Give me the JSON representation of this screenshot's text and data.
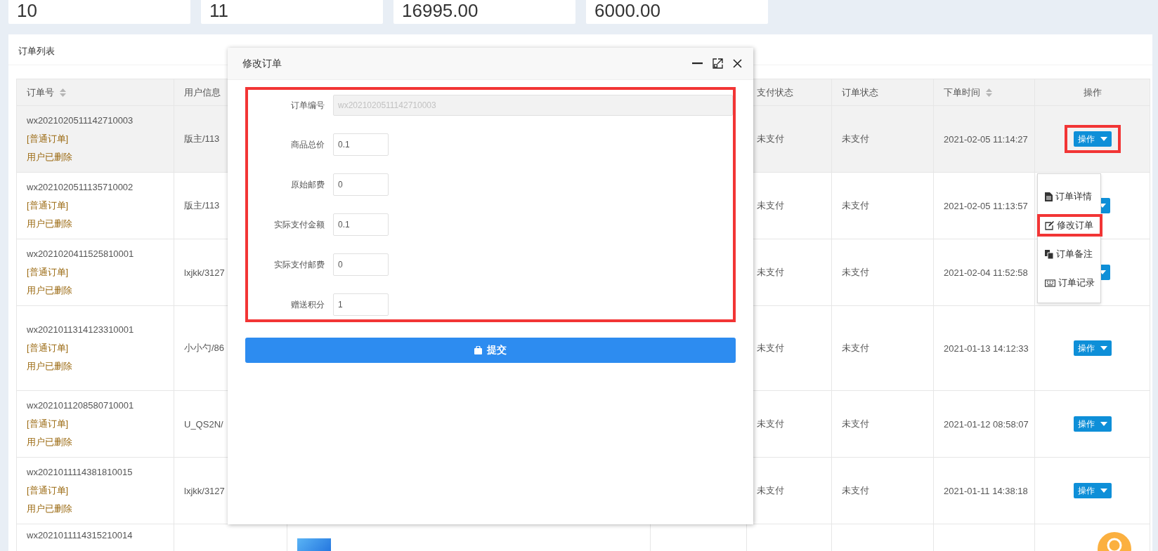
{
  "stat_cards": [
    "10",
    "11",
    "16995.00",
    "6000.00"
  ],
  "panel": {
    "title": "订单列表"
  },
  "table": {
    "columns": [
      {
        "label": "订单号",
        "sortable": true
      },
      {
        "label": "用户信息",
        "sortable": false
      },
      {
        "label": "支付状态",
        "sortable": false
      },
      {
        "label": "订单状态",
        "sortable": false
      },
      {
        "label": "下单时间",
        "sortable": true
      },
      {
        "label": "操作",
        "sortable": false
      }
    ],
    "rows": [
      {
        "selected": true,
        "order_no": "wx2021020511142710003",
        "order_type": "[普通订单]",
        "user_state": "用户已删除",
        "user": "版主/113",
        "pay_status": "未支付",
        "order_status": "未支付",
        "time": "2021-02-05 11:14:27",
        "action": {
          "label": "操作",
          "annotated": true
        }
      },
      {
        "selected": false,
        "order_no": "wx2021020511135710002",
        "order_type": "[普通订单]",
        "user_state": "用户已删除",
        "user": "版主/113",
        "pay_status": "未支付",
        "order_status": "未支付",
        "time": "2021-02-05 11:13:57",
        "action": {
          "annotated": false
        }
      },
      {
        "selected": false,
        "order_no": "wx2021020411525810001",
        "order_type": "[普通订单]",
        "user_state": "用户已删除",
        "user": "lxjkk/3127",
        "pay_status": "未支付",
        "order_status": "未支付",
        "time": "2021-02-04 11:52:58",
        "action": {
          "annotated": false
        }
      },
      {
        "selected": false,
        "order_no": "wx2021011314123310001",
        "order_type": "[普通订单]",
        "user_state": "用户已删除",
        "user": "小小勺/86",
        "pay_status": "未支付",
        "order_status": "未支付",
        "time": "2021-01-13 14:12:33",
        "action": {
          "label": "操作",
          "annotated": false
        }
      },
      {
        "selected": false,
        "order_no": "wx2021011208580710001",
        "order_type": "[普通订单]",
        "user_state": "用户已删除",
        "user": "U_QS2N/",
        "pay_status": "未支付",
        "order_status": "未支付",
        "time": "2021-01-12 08:58:07",
        "action": {
          "label": "操作",
          "annotated": false
        }
      },
      {
        "selected": false,
        "order_no": "wx2021011114381810015",
        "order_type": "[普通订单]",
        "user_state": "用户已删除",
        "user": "lxjkk/3127",
        "pay_status": "未支付",
        "order_status": "未支付",
        "time": "2021-01-11 14:38:18",
        "action": {
          "label": "操作",
          "annotated": false
        }
      },
      {
        "selected": false,
        "order_no": "wx2021011114315210014",
        "has_image": true
      }
    ]
  },
  "action_menu": {
    "items": [
      {
        "kind": "detail",
        "label": "订单详情",
        "annotated": false
      },
      {
        "kind": "edit",
        "label": "修改订单",
        "annotated": true
      },
      {
        "kind": "note",
        "label": "订单备注",
        "annotated": false
      },
      {
        "kind": "log",
        "label": "订单记录",
        "annotated": false
      }
    ]
  },
  "modal": {
    "title": "修改订单",
    "annotated": true,
    "fields": [
      {
        "label": "订单编号",
        "value": "wx2021020511142710003",
        "disabled": true
      },
      {
        "label": "商品总价",
        "value": "0.1",
        "disabled": false
      },
      {
        "label": "原始邮费",
        "value": "0",
        "disabled": false
      },
      {
        "label": "实际支付金额",
        "value": "0.1",
        "disabled": false
      },
      {
        "label": "实际支付邮费",
        "value": "0",
        "disabled": false
      },
      {
        "label": "赠送积分",
        "value": "1",
        "disabled": false
      }
    ],
    "submit": "提交"
  }
}
